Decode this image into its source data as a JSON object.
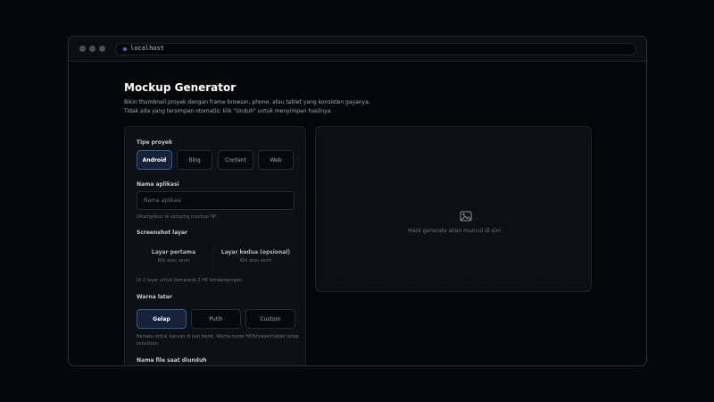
{
  "browser": {
    "url": "localhost"
  },
  "page": {
    "title": "Mockup Generator",
    "description": "Bikin thumbnail proyek dengan frame browser, phone, atau tablet yang konsisten gayanya. Tidak ada yang tersimpan otomatis; klik \"Unduh\" untuk menyimpan hasilnya."
  },
  "form": {
    "project_type": {
      "label": "Tipe proyek",
      "options": [
        "Android",
        "Blog",
        "Content",
        "Web"
      ],
      "selected": "Android"
    },
    "app_name": {
      "label": "Nama aplikasi",
      "placeholder": "Nama aplikasi",
      "value": "",
      "hint": "Ditampilkan di samping mockup HP."
    },
    "screenshots": {
      "label": "Screenshot layar",
      "slots": [
        {
          "title": "Layar pertama",
          "subtitle": "Klik atau seret"
        },
        {
          "title": "Layar kedua (opsional)",
          "subtitle": "Klik atau seret"
        }
      ],
      "hint": "Isi 2 layar untuk komposisi 2 HP berdampingan."
    },
    "background": {
      "label": "Warna latar",
      "options": [
        "Gelap",
        "Putih",
        "Custom"
      ],
      "selected": "Gelap",
      "hint": "Berlaku untuk kanvas di luar bezel. Warna bezel HP/browser/tablet tetap konsisten."
    },
    "filename": {
      "label": "Nama file saat diunduh"
    }
  },
  "preview": {
    "icon": "image-icon",
    "placeholder": "Hasil generate akan muncul di sini"
  },
  "colors": {
    "background": "#07080b",
    "panel": "#0d1016",
    "accent": "#3b5687",
    "accent_fill": "#16223a"
  }
}
